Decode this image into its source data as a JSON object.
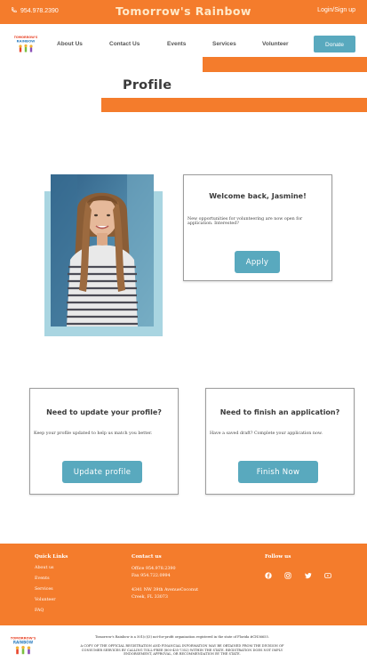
{
  "topbar": {
    "phone": "954.978.2390",
    "brand": "Tomorrow's Rainbow",
    "login": "Login/Sign up",
    "phone_icon": "phone-icon"
  },
  "nav": {
    "logo_text": "TOMORROW'S RAINBOW",
    "items": [
      "About Us",
      "Contact Us",
      "Events",
      "Services",
      "Volunteer"
    ],
    "donate": "Donate"
  },
  "page": {
    "title": "Profile"
  },
  "welcome_card": {
    "title": "Welcome back, Jasmine!",
    "text": "New opportunities for volunteering are now open for application. Interested?",
    "button": "Apply"
  },
  "update_card": {
    "title": "Need to update your profile?",
    "text": "Keep your profile updated to help us match you better.",
    "button": "Update profile"
  },
  "finish_card": {
    "title": "Need to finish an application?",
    "text": "Have a saved draft? Complete your application now.",
    "button": "Finish Now"
  },
  "footer": {
    "quick_links_heading": "Quick Links",
    "quick_links": [
      "About us",
      "Events",
      "Services",
      "Volunteer",
      "FAQ"
    ],
    "contact_heading": "Contact us",
    "office": "Office 954.978.2390",
    "fax": "Fax 954.722.0994",
    "address1": "4341 NW 39th AvenueCoconut",
    "address2": "Creek, FL 33073",
    "follow_heading": "Follow us",
    "social_icons": [
      "facebook-icon",
      "instagram-icon",
      "twitter-icon",
      "youtube-icon"
    ]
  },
  "legal": {
    "line1": "Tomorrow's Rainbow is a 501(c)(3) not-for-profit organization registered in the state of Florida #CH36655.",
    "line2": "A COPY OF THE OFFICIAL REGISTRATION AND FINANCIAL INFORMATION MAY BE OBTAINED FROM THE DIVISION OF",
    "line3": "CONSUMER SERVICES BY CALLING TOLL-FREE (800-435-7352) WITHIN THE STATE. REGISTRATION DOES NOT IMPLY",
    "line4": "ENDORSEMENT, APPROVAL, OR RECOMMENDATION BY THE STATE."
  },
  "colors": {
    "orange": "#f47c2c",
    "teal": "#59a9be",
    "light_blue": "#a9d5e1"
  }
}
